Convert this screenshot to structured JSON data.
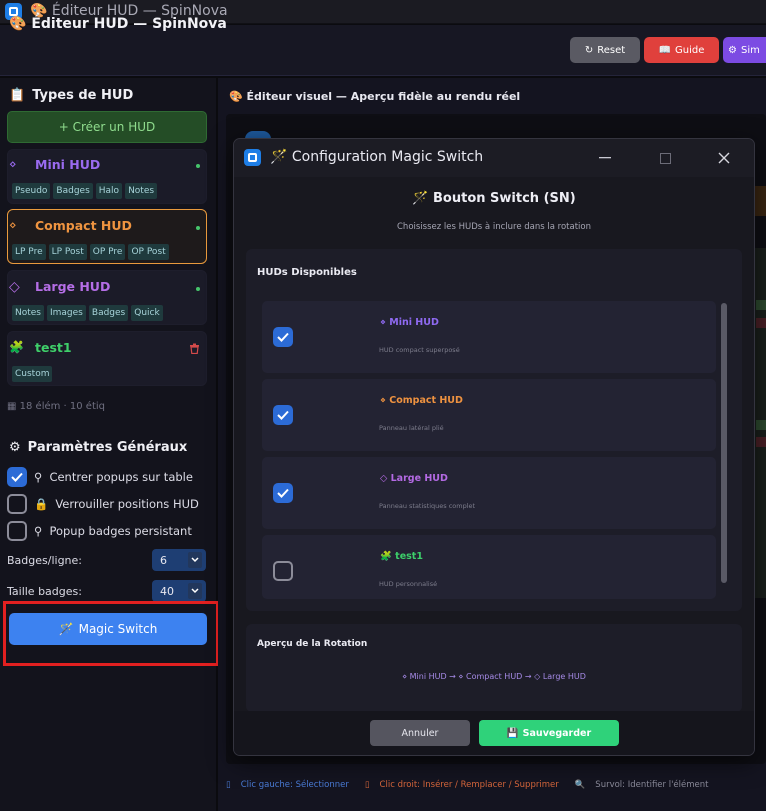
{
  "os": {
    "title": "Éditeur HUD — SpinNova"
  },
  "header": {
    "title": "Éditeur HUD — SpinNova",
    "buttons": [
      {
        "label": "Reset",
        "color": "#5a5a63"
      },
      {
        "label": "Guide",
        "color": "#e0403c"
      },
      {
        "label": "Sim",
        "color": "#7c4be3"
      }
    ]
  },
  "sidebar": {
    "types_title": "Types de HUD",
    "create_label": "+ Créer un HUD",
    "cards": [
      {
        "title": "Mini HUD",
        "icon": "⋄",
        "color": "#9a6bf0",
        "tags": [
          "Pseudo",
          "Badges",
          "Halo",
          "Notes"
        ]
      },
      {
        "title": "Compact HUD",
        "icon": "⋄",
        "color": "#ef9440",
        "tags": [
          "LP Pre",
          "LP Post",
          "OP Pre",
          "OP Post"
        ]
      },
      {
        "title": "Large HUD",
        "icon": "◇",
        "color": "#b56ee6",
        "tags": [
          "Notes",
          "Images",
          "Badges",
          "Quick"
        ]
      },
      {
        "title": "test1",
        "icon": "🧩",
        "color": "#3fd06a",
        "tags": [
          "Custom"
        ]
      }
    ],
    "stats": "18 élém · 10 étiq",
    "params_title": "Paramètres Généraux",
    "checks": [
      {
        "label": "Centrer popups sur table",
        "checked": true
      },
      {
        "label": "Verrouiller positions HUD",
        "checked": false
      },
      {
        "label": "Popup badges persistant",
        "checked": false
      }
    ],
    "badges_per_line_label": "Badges/ligne:",
    "badges_per_line_value": "6",
    "badge_size_label": "Taille badges:",
    "badge_size_value": "40",
    "magic_label": "Magic Switch"
  },
  "main": {
    "title": "Éditeur visuel — Aperçu fidèle au rendu réel",
    "footer": [
      {
        "text": "Clic gauche: Sélectionner",
        "color": "#4a7bd6"
      },
      {
        "text": "Clic droit: Insérer / Remplacer / Supprimer",
        "color": "#d6663b"
      },
      {
        "text": "Survol: Identifier l'élément",
        "color": "#8a8a99"
      }
    ]
  },
  "dialog": {
    "title": "Configuration Magic Switch",
    "heading": "Bouton Switch (SN)",
    "subtitle": "Choisissez les HUDs à inclure dans la rotation",
    "available_title": "HUDs Disponibles",
    "huds": [
      {
        "name": "Mini HUD",
        "icon": "⋄",
        "color": "#8f6af2",
        "desc": "HUD compact superposé",
        "checked": true
      },
      {
        "name": "Compact HUD",
        "icon": "⋄",
        "color": "#ee9240",
        "desc": "Panneau latéral plié",
        "checked": true
      },
      {
        "name": "Large HUD",
        "icon": "◇",
        "color": "#b46ae4",
        "desc": "Panneau statistiques complet",
        "checked": true
      },
      {
        "name": "test1",
        "icon": "🧩",
        "color": "#3ccf6a",
        "desc": "HUD personnalisé",
        "checked": false
      }
    ],
    "preview_title": "Aperçu de la Rotation",
    "rotation": "⋄ Mini HUD → ⋄ Compact HUD → ◇ Large HUD",
    "cancel_label": "Annuler",
    "save_label": "Sauvegarder"
  }
}
